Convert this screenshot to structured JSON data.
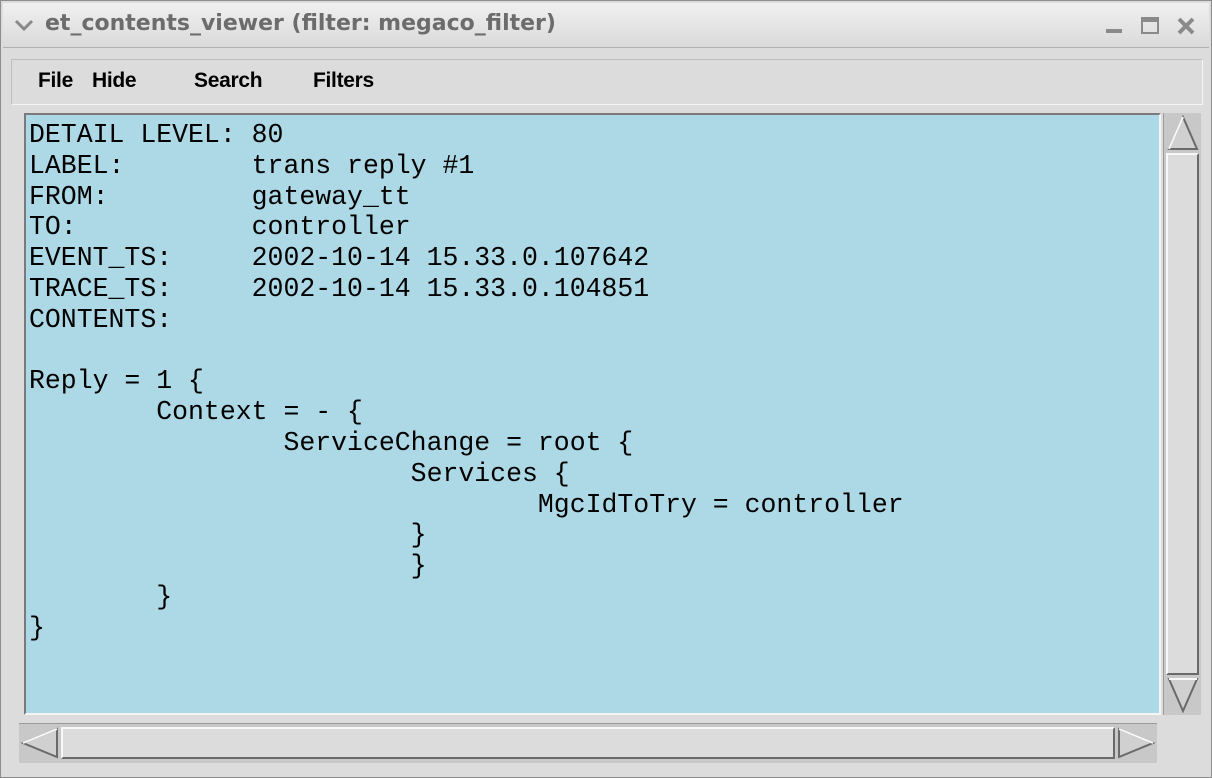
{
  "window": {
    "title": "et_contents_viewer (filter: megaco_filter)",
    "icons": {
      "menu": "chevron-down-icon",
      "minimize": "minimize-icon",
      "maximize": "maximize-icon",
      "close": "close-icon"
    }
  },
  "menubar": {
    "items": [
      {
        "label": "File"
      },
      {
        "label": "Hide"
      },
      {
        "label": "Search"
      },
      {
        "label": "Filters"
      }
    ]
  },
  "content": {
    "background_color": "#add8e6",
    "text": "DETAIL LEVEL: 80\nLABEL:        trans reply #1\nFROM:         gateway_tt\nTO:           controller\nEVENT_TS:     2002-10-14 15.33.0.107642\nTRACE_TS:     2002-10-14 15.33.0.104851\nCONTENTS:\n\nReply = 1 {\n        Context = - {\n                ServiceChange = root {\n                        Services {\n                                MgcIdToTry = controller\n                        }\n                        }\n        }\n}"
  }
}
